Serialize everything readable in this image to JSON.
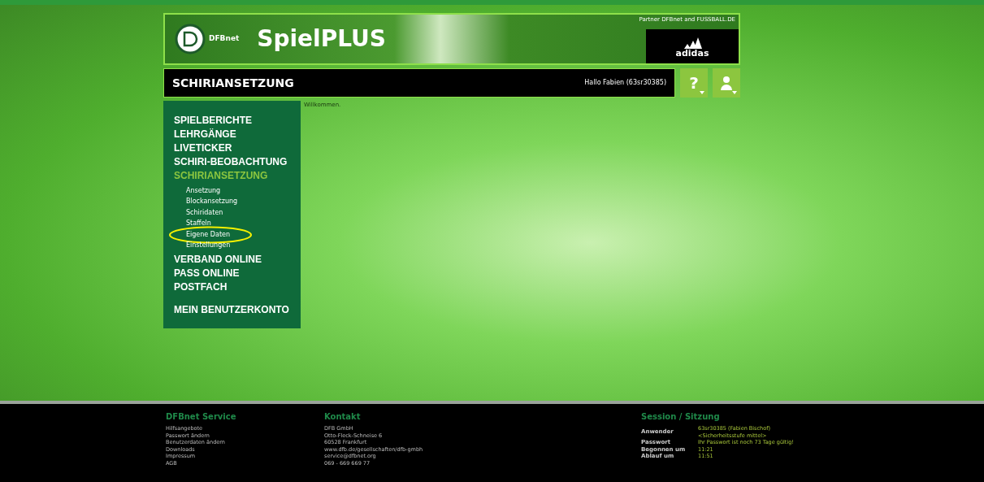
{
  "banner": {
    "brand": "DFBnet",
    "title": "SpielPLUS",
    "partner": "Partner DFBnet and FUSSBALL.DE",
    "sponsor": "adidas"
  },
  "bar": {
    "title": "SCHIRIANSETZUNG",
    "greeting": "Hallo Fabien (63sr30385)",
    "help": "?"
  },
  "menu": [
    {
      "label": "SPIELBERICHTE",
      "selected": false
    },
    {
      "label": "LEHRGÄNGE",
      "selected": false
    },
    {
      "label": "LIVETICKER",
      "selected": false
    },
    {
      "label": "SCHIRI-BEOBACHTUNG",
      "selected": false
    },
    {
      "label": "SCHIRIANSETZUNG",
      "selected": true,
      "children": [
        {
          "label": "Ansetzung",
          "highlighted": false
        },
        {
          "label": "Blockansetzung",
          "highlighted": false
        },
        {
          "label": "Schiridaten",
          "highlighted": false
        },
        {
          "label": "Staffeln",
          "highlighted": false
        },
        {
          "label": "Eigene Daten",
          "highlighted": true
        },
        {
          "label": "Einstellungen",
          "highlighted": false
        }
      ]
    },
    {
      "label": "VERBAND ONLINE",
      "selected": false
    },
    {
      "label": "PASS ONLINE",
      "selected": false
    },
    {
      "label": "POSTFACH",
      "selected": false
    },
    {
      "label": "MEIN BENUTZERKONTO",
      "selected": false,
      "gap": true
    }
  ],
  "content": {
    "welcome": "Willkommen."
  },
  "footer": {
    "service": {
      "title": "DFBnet Service",
      "links": [
        "Hilfsangebote",
        "Passwort ändern",
        "Benutzerdaten ändern",
        "Downloads",
        "Impressum",
        "AGB"
      ]
    },
    "contact": {
      "title": "Kontakt",
      "lines": [
        "DFB GmbH",
        "Otto-Fleck-Schneise 6",
        "60528 Frankfurt",
        "www.dfb.de/gesellschaften/dfb-gmbh",
        "service@dfbnet.org",
        "069 - 669 669 77"
      ]
    },
    "session": {
      "title": "Session / Sitzung",
      "rows": [
        {
          "label": "Anwender",
          "lines": [
            "63sr30385 (Fabien Bischof)",
            "<Sicherheitsstufe mittel>"
          ]
        },
        {
          "label": "Passwort",
          "lines": [
            "Ihr Passwort ist noch 73 Tage gültig!"
          ]
        },
        {
          "label": "Begonnen um",
          "lines": [
            "11:21"
          ]
        },
        {
          "label": "Ablauf um",
          "lines": [
            "11:51"
          ]
        }
      ]
    }
  }
}
